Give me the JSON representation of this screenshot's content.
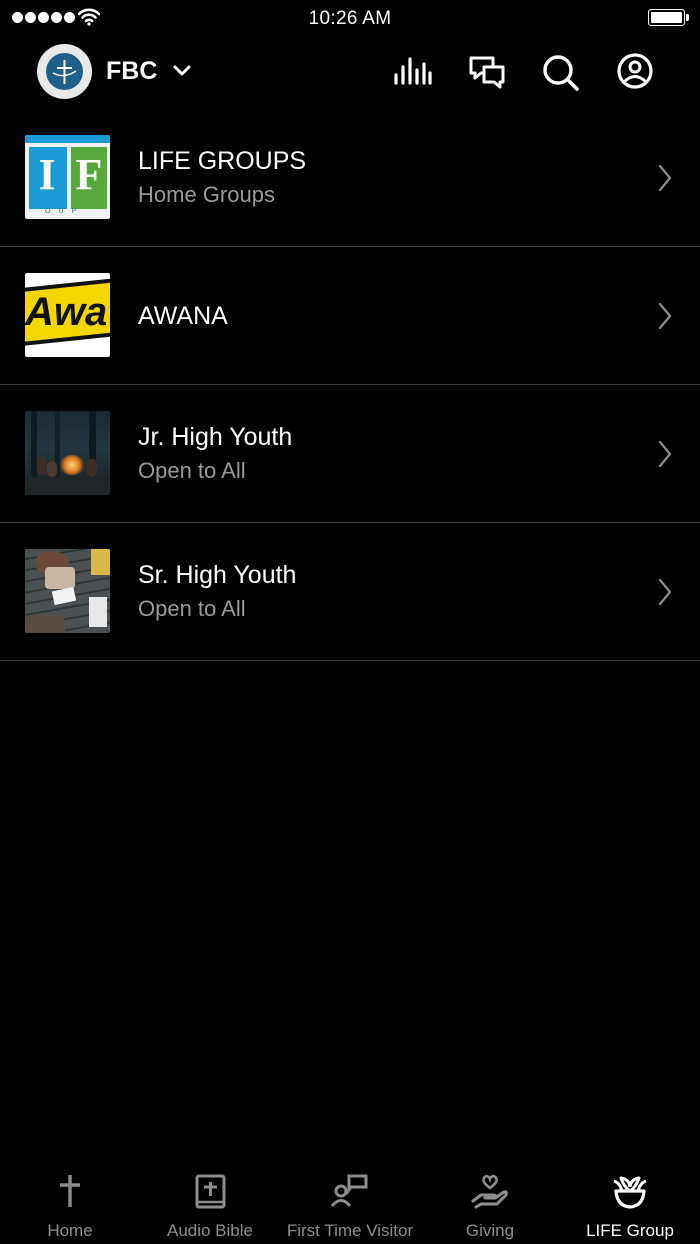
{
  "status_bar": {
    "time": "10:26 AM"
  },
  "header": {
    "org_name": "FBC"
  },
  "groups": [
    {
      "title": "LIFE GROUPS",
      "subtitle": "Home Groups"
    },
    {
      "title": "AWANA",
      "subtitle": ""
    },
    {
      "title": "Jr. High Youth",
      "subtitle": "Open to All"
    },
    {
      "title": "Sr. High Youth",
      "subtitle": "Open to All"
    }
  ],
  "tabs": [
    {
      "label": "Home",
      "icon": "cross-icon"
    },
    {
      "label": "Audio Bible",
      "icon": "bible-icon"
    },
    {
      "label": "First Time Visitor",
      "icon": "visitor-icon"
    },
    {
      "label": "Giving",
      "icon": "giving-icon"
    },
    {
      "label": "LIFE Group",
      "icon": "plant-icon"
    }
  ],
  "active_tab": "LIFE Group",
  "thumb_text": {
    "life_letters": [
      "I",
      "F"
    ],
    "life_caption": "OUP",
    "awana_text": "Awa"
  },
  "colors": {
    "background": "#000000",
    "text": "#ffffff",
    "muted": "#9a9a9a",
    "tab_inactive": "#8e8e8e",
    "divider": "#3a3a3a"
  }
}
